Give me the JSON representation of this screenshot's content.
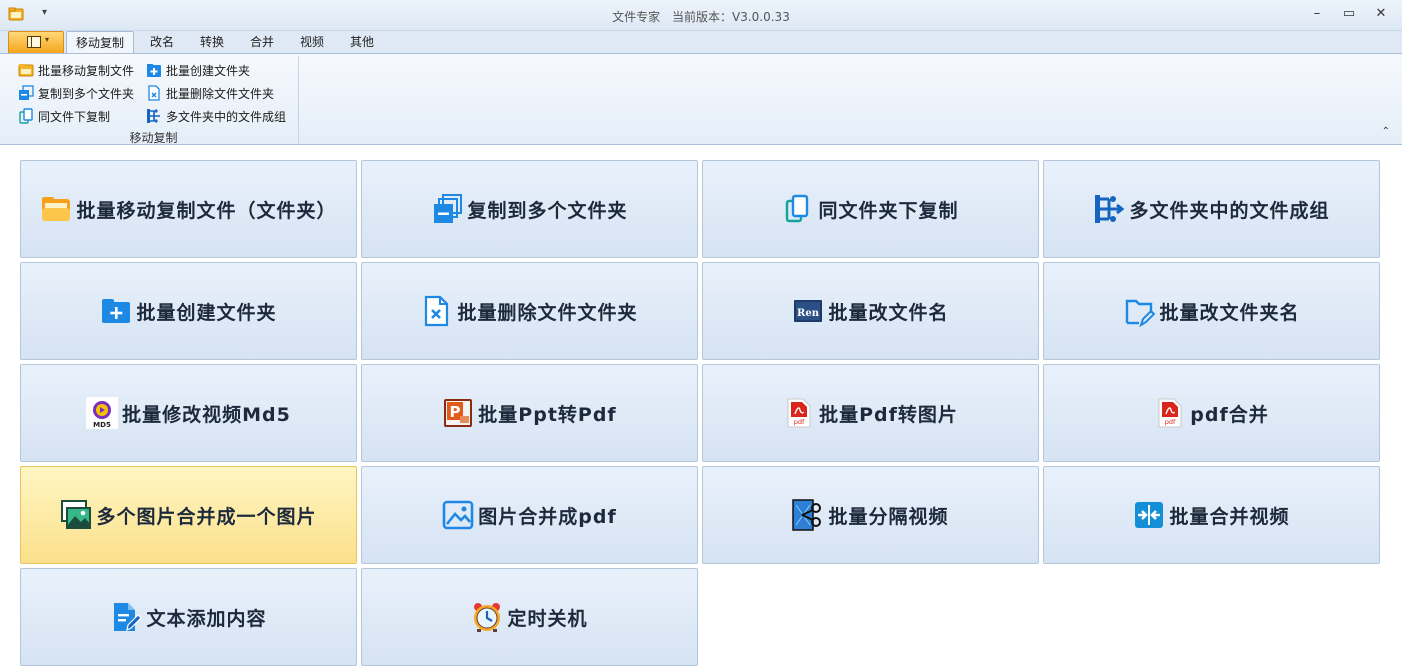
{
  "window": {
    "app_name": "文件专家",
    "version_label": "当前版本：V3.0.0.33",
    "qa_arrow": "▾",
    "minimize": "–",
    "restore": "▭",
    "close": "✕"
  },
  "tabs": [
    {
      "label": "移动复制",
      "active": true
    },
    {
      "label": "改名",
      "active": false
    },
    {
      "label": "转换",
      "active": false
    },
    {
      "label": "合并",
      "active": false
    },
    {
      "label": "视频",
      "active": false
    },
    {
      "label": "其他",
      "active": false
    }
  ],
  "ribbon": {
    "group_label": "移动复制",
    "collapse_glyph": "⌃",
    "items": [
      {
        "label": "批量移动复制文件",
        "icon": "folder-icon"
      },
      {
        "label": "复制到多个文件夹",
        "icon": "copy-stack-icon"
      },
      {
        "label": "同文件下复制",
        "icon": "duplicate-icon"
      },
      {
        "label": "批量创建文件夹",
        "icon": "add-folder-icon"
      },
      {
        "label": "批量删除文件文件夹",
        "icon": "delete-file-icon"
      },
      {
        "label": "多文件夹中的文件成组",
        "icon": "group-icon"
      }
    ]
  },
  "tiles": [
    {
      "label": "批量移动复制文件（文件夹）",
      "icon": "folder-icon"
    },
    {
      "label": "复制到多个文件夹",
      "icon": "copy-stack-icon"
    },
    {
      "label": "同文件夹下复制",
      "icon": "duplicate-icon"
    },
    {
      "label": "多文件夹中的文件成组",
      "icon": "group-icon"
    },
    {
      "label": "批量创建文件夹",
      "icon": "add-folder-icon"
    },
    {
      "label": "批量删除文件文件夹",
      "icon": "delete-file-icon"
    },
    {
      "label": "批量改文件名",
      "icon": "rename-file-icon",
      "icon_text": "Ren"
    },
    {
      "label": "批量改文件夹名",
      "icon": "rename-folder-icon"
    },
    {
      "label": "批量修改视频Md5",
      "icon": "md5-video-icon",
      "icon_text": "MD5"
    },
    {
      "label": "批量Ppt转Pdf",
      "icon": "ppt-icon",
      "icon_text": "P"
    },
    {
      "label": "批量Pdf转图片",
      "icon": "pdf-icon",
      "icon_text": "pdf"
    },
    {
      "label": "pdf合并",
      "icon": "pdf-icon",
      "icon_text": "pdf"
    },
    {
      "label": "多个图片合并成一个图片",
      "icon": "image-stack-icon",
      "highlighted": true
    },
    {
      "label": "图片合并成pdf",
      "icon": "image-icon"
    },
    {
      "label": "批量分隔视频",
      "icon": "scissors-video-icon"
    },
    {
      "label": "批量合并视频",
      "icon": "merge-video-icon"
    },
    {
      "label": "文本添加内容",
      "icon": "edit-document-icon"
    },
    {
      "label": "定时关机",
      "icon": "alarm-clock-icon"
    }
  ],
  "colors": {
    "accent_blue": "#1e88e5",
    "tile_bg": "#dde8f5",
    "tile_highlight": "#fbe08a",
    "file_tab": "#f4a51c"
  }
}
